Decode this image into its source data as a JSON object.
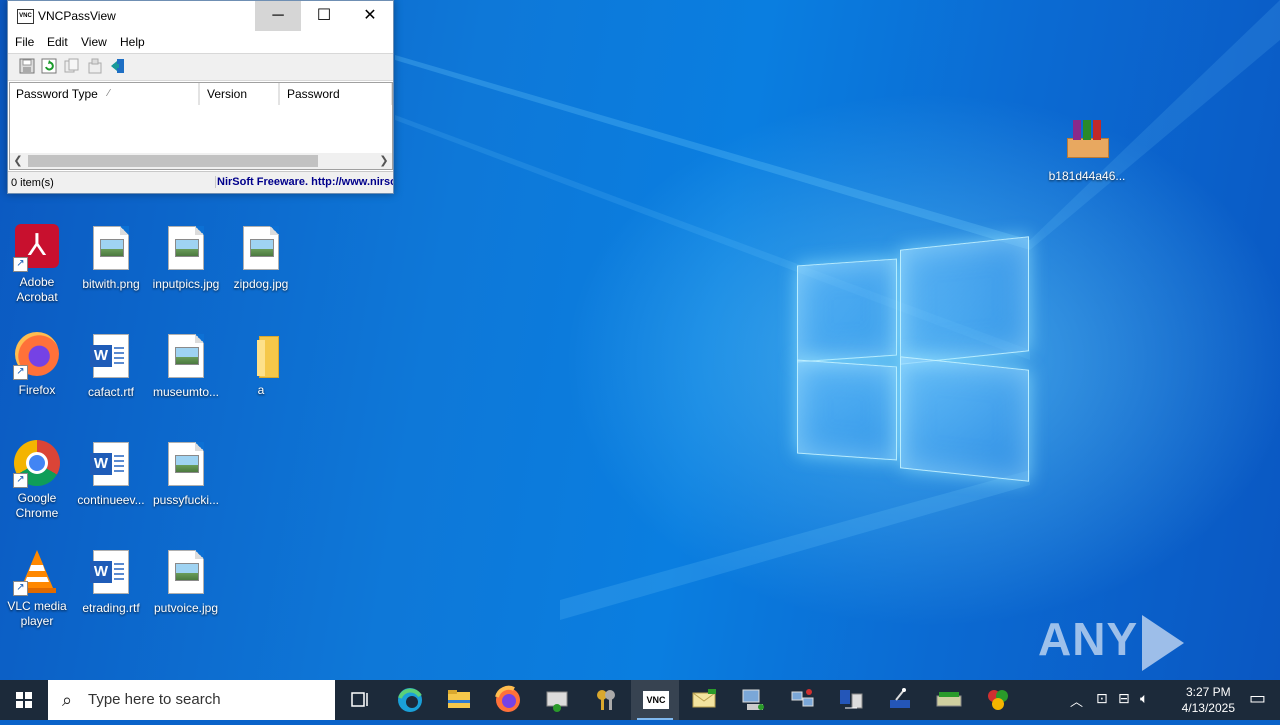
{
  "window": {
    "title": "VNCPassView",
    "app_icon": "VNC",
    "menu": [
      "File",
      "Edit",
      "View",
      "Help"
    ],
    "toolbar_icons": [
      "save-icon",
      "refresh-icon",
      "copy-icon",
      "properties-icon",
      "exit-icon"
    ],
    "columns": [
      {
        "label": "Password Type",
        "sort_indicator": "⁄"
      },
      {
        "label": "Version"
      },
      {
        "label": "Password"
      }
    ],
    "status_left": "0 item(s)",
    "status_right": "NirSoft Freeware.  http://www.nirsoft.net"
  },
  "desktop_icons": [
    {
      "label": "Adobe Acrobat",
      "icon": "adobe-acrobat-icon"
    },
    {
      "label": "bitwith.png",
      "icon": "image-file-icon"
    },
    {
      "label": "inputpics.jpg",
      "icon": "image-file-icon"
    },
    {
      "label": "zipdog.jpg",
      "icon": "image-file-icon"
    },
    {
      "label": "Firefox",
      "icon": "firefox-icon"
    },
    {
      "label": "cafact.rtf",
      "icon": "word-document-icon"
    },
    {
      "label": "museumto...",
      "icon": "image-file-icon"
    },
    {
      "label": "a",
      "icon": "folder-icon"
    },
    {
      "label": "Google Chrome",
      "icon": "chrome-icon"
    },
    {
      "label": "continueev...",
      "icon": "word-document-icon"
    },
    {
      "label": "pussyfucki...",
      "icon": "image-file-icon"
    },
    {
      "label": "VLC media player",
      "icon": "vlc-icon"
    },
    {
      "label": "etrading.rtf",
      "icon": "word-document-icon"
    },
    {
      "label": "putvoice.jpg",
      "icon": "image-file-icon"
    },
    {
      "label": "b181d44a46...",
      "icon": "winrar-archive-icon"
    }
  ],
  "watermark": {
    "left": "ANY",
    "right": "RUN"
  },
  "taskbar": {
    "search_placeholder": "Type here to search",
    "time": "3:27 PM",
    "date": "4/13/2025",
    "vnc_label": "VNC"
  },
  "colors": {
    "accent": "#0a63c9",
    "taskbar": "#1c2a3a",
    "nirsoft_link": "#00008b"
  }
}
